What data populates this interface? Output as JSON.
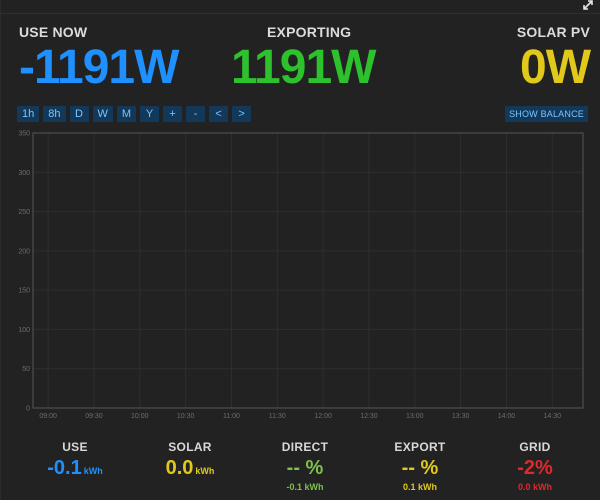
{
  "colors": {
    "use": "#1e90ff",
    "export": "#2ec12e",
    "solar": "#e0c91b",
    "direct": "#7fbf4f",
    "grid": "#e0292b",
    "button_bg": "#13395a",
    "button_text": "#7cc4ff"
  },
  "header": {
    "expand_icon": "expand-icon"
  },
  "stats": {
    "use": {
      "label": "USE NOW",
      "value": "-1191W"
    },
    "exporting": {
      "label": "EXPORTING",
      "value": "1191W"
    },
    "solar": {
      "label": "SOLAR PV",
      "value": "0W"
    }
  },
  "toolbar": {
    "buttons": [
      "1h",
      "8h",
      "D",
      "W",
      "M",
      "Y",
      "+",
      "-",
      "<",
      ">"
    ],
    "balance_label": "SHOW BALANCE"
  },
  "chart_data": {
    "type": "line",
    "x_ticks": [
      "09:00",
      "09:30",
      "10:00",
      "10:30",
      "11:00",
      "11:30",
      "12:00",
      "12:30",
      "13:00",
      "13:30",
      "14:00",
      "14:30"
    ],
    "y_ticks": [
      0,
      50,
      100,
      150,
      200,
      250,
      300,
      350
    ],
    "ylim": [
      0,
      350
    ],
    "grid": true,
    "series": []
  },
  "summary": {
    "use": {
      "label": "USE",
      "value": "-0.1",
      "unit": "kWh"
    },
    "solar": {
      "label": "SOLAR",
      "value": "0.0",
      "unit": "kWh"
    },
    "direct": {
      "label": "DIRECT",
      "value": "-- %",
      "sub": "-0.1 kWh"
    },
    "export": {
      "label": "EXPORT",
      "value": "-- %",
      "sub": "0.1 kWh"
    },
    "grid": {
      "label": "GRID",
      "value": "-2%",
      "sub": "0.0 kWh"
    }
  }
}
